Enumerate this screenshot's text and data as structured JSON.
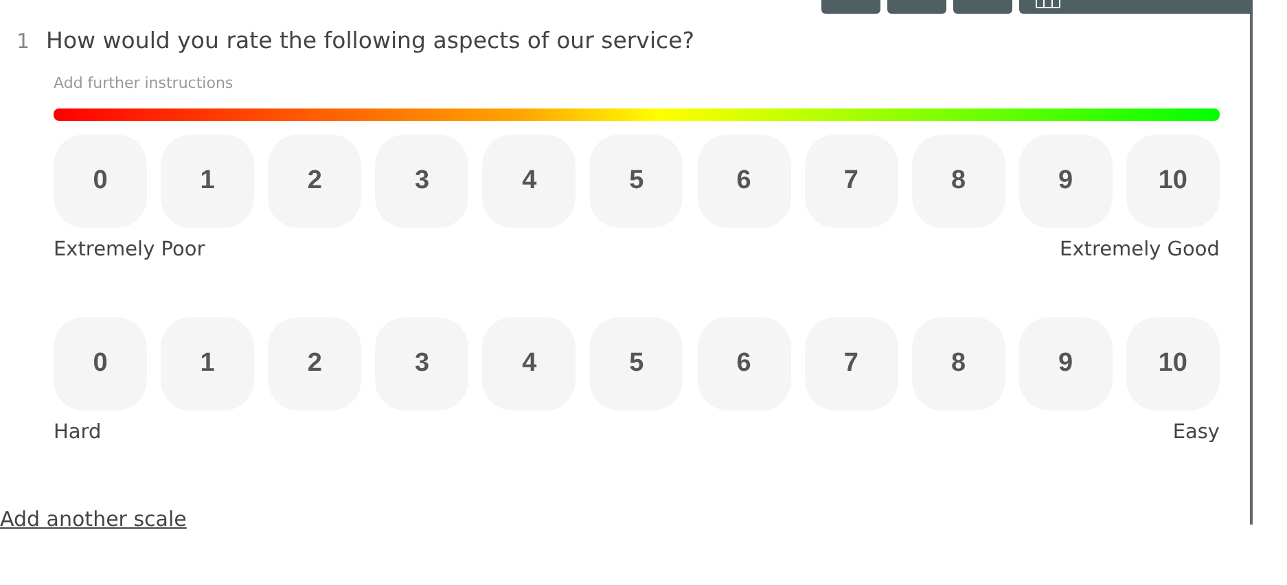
{
  "toolbar": [
    {
      "kind": "plain"
    },
    {
      "kind": "plain"
    },
    {
      "kind": "plain"
    },
    {
      "kind": "table"
    }
  ],
  "question": {
    "number": "1",
    "title": "How would you rate the following aspects of our service?",
    "instructions": {
      "placeholder": "Add further instructions"
    }
  },
  "scales": [
    {
      "options": [
        "0",
        "1",
        "2",
        "3",
        "4",
        "5",
        "6",
        "7",
        "8",
        "9",
        "10"
      ],
      "low_label": "Extremely Poor",
      "high_label": "Extremely Good"
    },
    {
      "options": [
        "0",
        "1",
        "2",
        "3",
        "4",
        "5",
        "6",
        "7",
        "8",
        "9",
        "10"
      ],
      "low_label": "Hard",
      "high_label": "Easy"
    }
  ],
  "add_scale_link": "Add another scale"
}
